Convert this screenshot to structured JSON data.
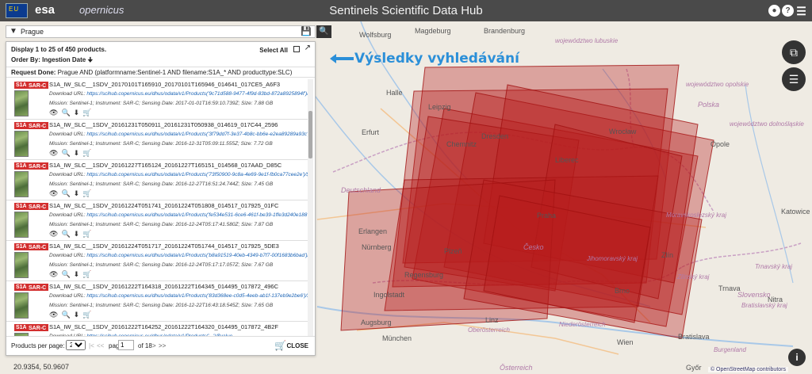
{
  "header": {
    "title": "Sentinels Scientific Data Hub",
    "eu_logo": "EU",
    "esa_logo": "esa",
    "copernicus_logo": "opernicus",
    "user_icon": "user-icon",
    "help_icon": "help-icon",
    "menu_icon": "hamburger-menu-icon"
  },
  "search": {
    "value": "Prague",
    "filter_icon": "filter-icon",
    "save_icon": "floppy-disk-icon",
    "search_icon": "search-icon"
  },
  "results": {
    "display_text": "Display 1 to 25 of 450 products.",
    "order_by": "Order By: Ingestion Date ",
    "select_all": "Select All",
    "request_label": "Request Done:",
    "request_text": " Prague AND (platformname:Sentinel-1 AND filename:S1A_* AND producttype:SLC)",
    "items": [
      {
        "badge1": "S1A",
        "badge2": "SAR-C",
        "name": "S1A_IW_SLC__1SDV_20170101T165910_20170101T165946_014641_017CE5_A6F3",
        "dl_label": "Download URL: ",
        "url": "https://scihub.copernicus.eu/dhus/odata/v1/Products('9c71d588-9477-4f9d-83bd-872a8925894f')/$value",
        "meta": "Mission: Sentinel-1; Instrument: SAR-C; Sensing Date: 2017-01-01T16:59:10.739Z; Size: 7.88 GB"
      },
      {
        "badge1": "S1A",
        "badge2": "SAR-C",
        "name": "S1A_IW_SLC__1SDV_20161231T050911_20161231T050938_014619_017C44_2596",
        "dl_label": "Download URL: ",
        "url": "https://scihub.copernicus.eu/dhus/odata/v1/Products('3f79dd7f-3e37-4b8c-bb6e-e2ea89289a93c')/$value",
        "meta": "Mission: Sentinel-1; Instrument: SAR-C; Sensing Date: 2016-12-31T05:09:11.555Z; Size: 7.72 GB"
      },
      {
        "badge1": "S1A",
        "badge2": "SAR-C",
        "name": "S1A_IW_SLC__1SDV_20161227T165124_20161227T165151_014568_017AAD_D85C",
        "dl_label": "Download URL: ",
        "url": "https://scihub.copernicus.eu/dhus/odata/v1/Products('73f50900-9c8a-4e69-9e1f-fb0ca77cee2e')/$value",
        "meta": "Mission: Sentinel-1; Instrument: SAR-C; Sensing Date: 2016-12-27T16:51:24.744Z; Size: 7.45 GB"
      },
      {
        "badge1": "S1A",
        "badge2": "SAR-C",
        "name": "S1A_IW_SLC__1SDV_20161224T051741_20161224T051808_014517_017925_01FC",
        "dl_label": "Download URL: ",
        "url": "https://scihub.copernicus.eu/dhus/odata/v1/Products('fe534e531-6ce6-461f-be39-1ffe3d240e188')/$value",
        "meta": "Mission: Sentinel-1; Instrument: SAR-C; Sensing Date: 2016-12-24T05:17:41.580Z; Size: 7.87 GB"
      },
      {
        "badge1": "S1A",
        "badge2": "SAR-C",
        "name": "S1A_IW_SLC__1SDV_20161224T051717_20161224T051744_014517_017925_5DE3",
        "dl_label": "Download URL: ",
        "url": "https://scihub.copernicus.eu/dhus/odata/v1/Products('b8a91519-40eb-4349-b7f7-00f1683b6bad')/$value",
        "meta": "Mission: Sentinel-1; Instrument: SAR-C; Sensing Date: 2016-12-24T05:17:17.057Z; Size: 7.67 GB"
      },
      {
        "badge1": "S1A",
        "badge2": "SAR-C",
        "name": "S1A_IW_SLC__1SDV_20161222T164318_20161222T164345_014495_017872_496C",
        "dl_label": "Download URL: ",
        "url": "https://scihub.copernicus.eu/dhus/odata/v1/Products('83d368ee-c0d5-4eeb-ab1f-137eb9e2be6')/$value",
        "meta": "Mission: Sentinel-1; Instrument: SAR-C; Sensing Date: 2016-12-22T16:43:18.545Z; Size: 7.65 GB"
      },
      {
        "badge1": "S1A",
        "badge2": "SAR-C",
        "name": "S1A_IW_SLC__1SDV_20161222T164252_20161222T164320_014495_017872_4B2F",
        "dl_label": "Download URL: ",
        "url": "https://scihub.copernicus.eu/dhus/odata/v1/Products('...')/$value",
        "meta": "Mission: Sentinel-1; Instrument: SAR-C"
      }
    ]
  },
  "pagination": {
    "products_per_page_label": "Products per page:",
    "per_page": "25",
    "prev_first": "|<",
    "prev": "<<",
    "page_label": "page:",
    "page": "1",
    "of_text": "of 18",
    "next": ">",
    "next_last": ">>",
    "close": "CLOSE"
  },
  "map": {
    "annotation": "Výsledky vyhledávání",
    "coords": "20.9354, 50.9607",
    "attribution": "© OpenStreetMap contributors",
    "places": [
      {
        "t": "Wolfsburg"
      },
      {
        "t": "Magdeburg"
      },
      {
        "t": "Leipzig"
      },
      {
        "t": "Erfurt"
      },
      {
        "t": "Dresden"
      },
      {
        "t": "Chemnitz"
      },
      {
        "t": "Praha"
      },
      {
        "t": "Nürnberg"
      },
      {
        "t": "Regensburg"
      },
      {
        "t": "Erlangen"
      },
      {
        "t": "Ingolstadt"
      },
      {
        "t": "Augsburg"
      },
      {
        "t": "München"
      },
      {
        "t": "Wrocław"
      },
      {
        "t": "Opole"
      },
      {
        "t": "Brno"
      },
      {
        "t": "Bratislava"
      },
      {
        "t": "Wien"
      },
      {
        "t": "Linz"
      },
      {
        "t": "Zlín"
      },
      {
        "t": "Trnava"
      },
      {
        "t": "Nitra"
      },
      {
        "t": "Győr"
      },
      {
        "t": "Halle"
      },
      {
        "t": "Plzeň"
      },
      {
        "t": "Brandenburg"
      },
      {
        "t": "Liberec"
      },
      {
        "t": "Katowice"
      }
    ],
    "countries": [
      {
        "t": "Deutschland"
      },
      {
        "t": "Česko"
      },
      {
        "t": "Österreich"
      },
      {
        "t": "Slovensko"
      },
      {
        "t": "Polska"
      }
    ],
    "regions": [
      {
        "t": "Niederösterreich"
      },
      {
        "t": "Oberösterreich"
      },
      {
        "t": "Jihomoravský kraj"
      },
      {
        "t": "Bratislavský kraj"
      },
      {
        "t": "Moravskoslezský kraj"
      },
      {
        "t": "Trnavský kraj"
      },
      {
        "t": "województwo opolskie"
      },
      {
        "t": "województwo dolnośląskie"
      },
      {
        "t": "województwo lubuskie"
      },
      {
        "t": "Zlínský kraj"
      },
      {
        "t": "Burgenland"
      }
    ],
    "layers_icon": "layers-icon",
    "basemap_icon": "copy-icon",
    "info_icon": "info-icon"
  }
}
